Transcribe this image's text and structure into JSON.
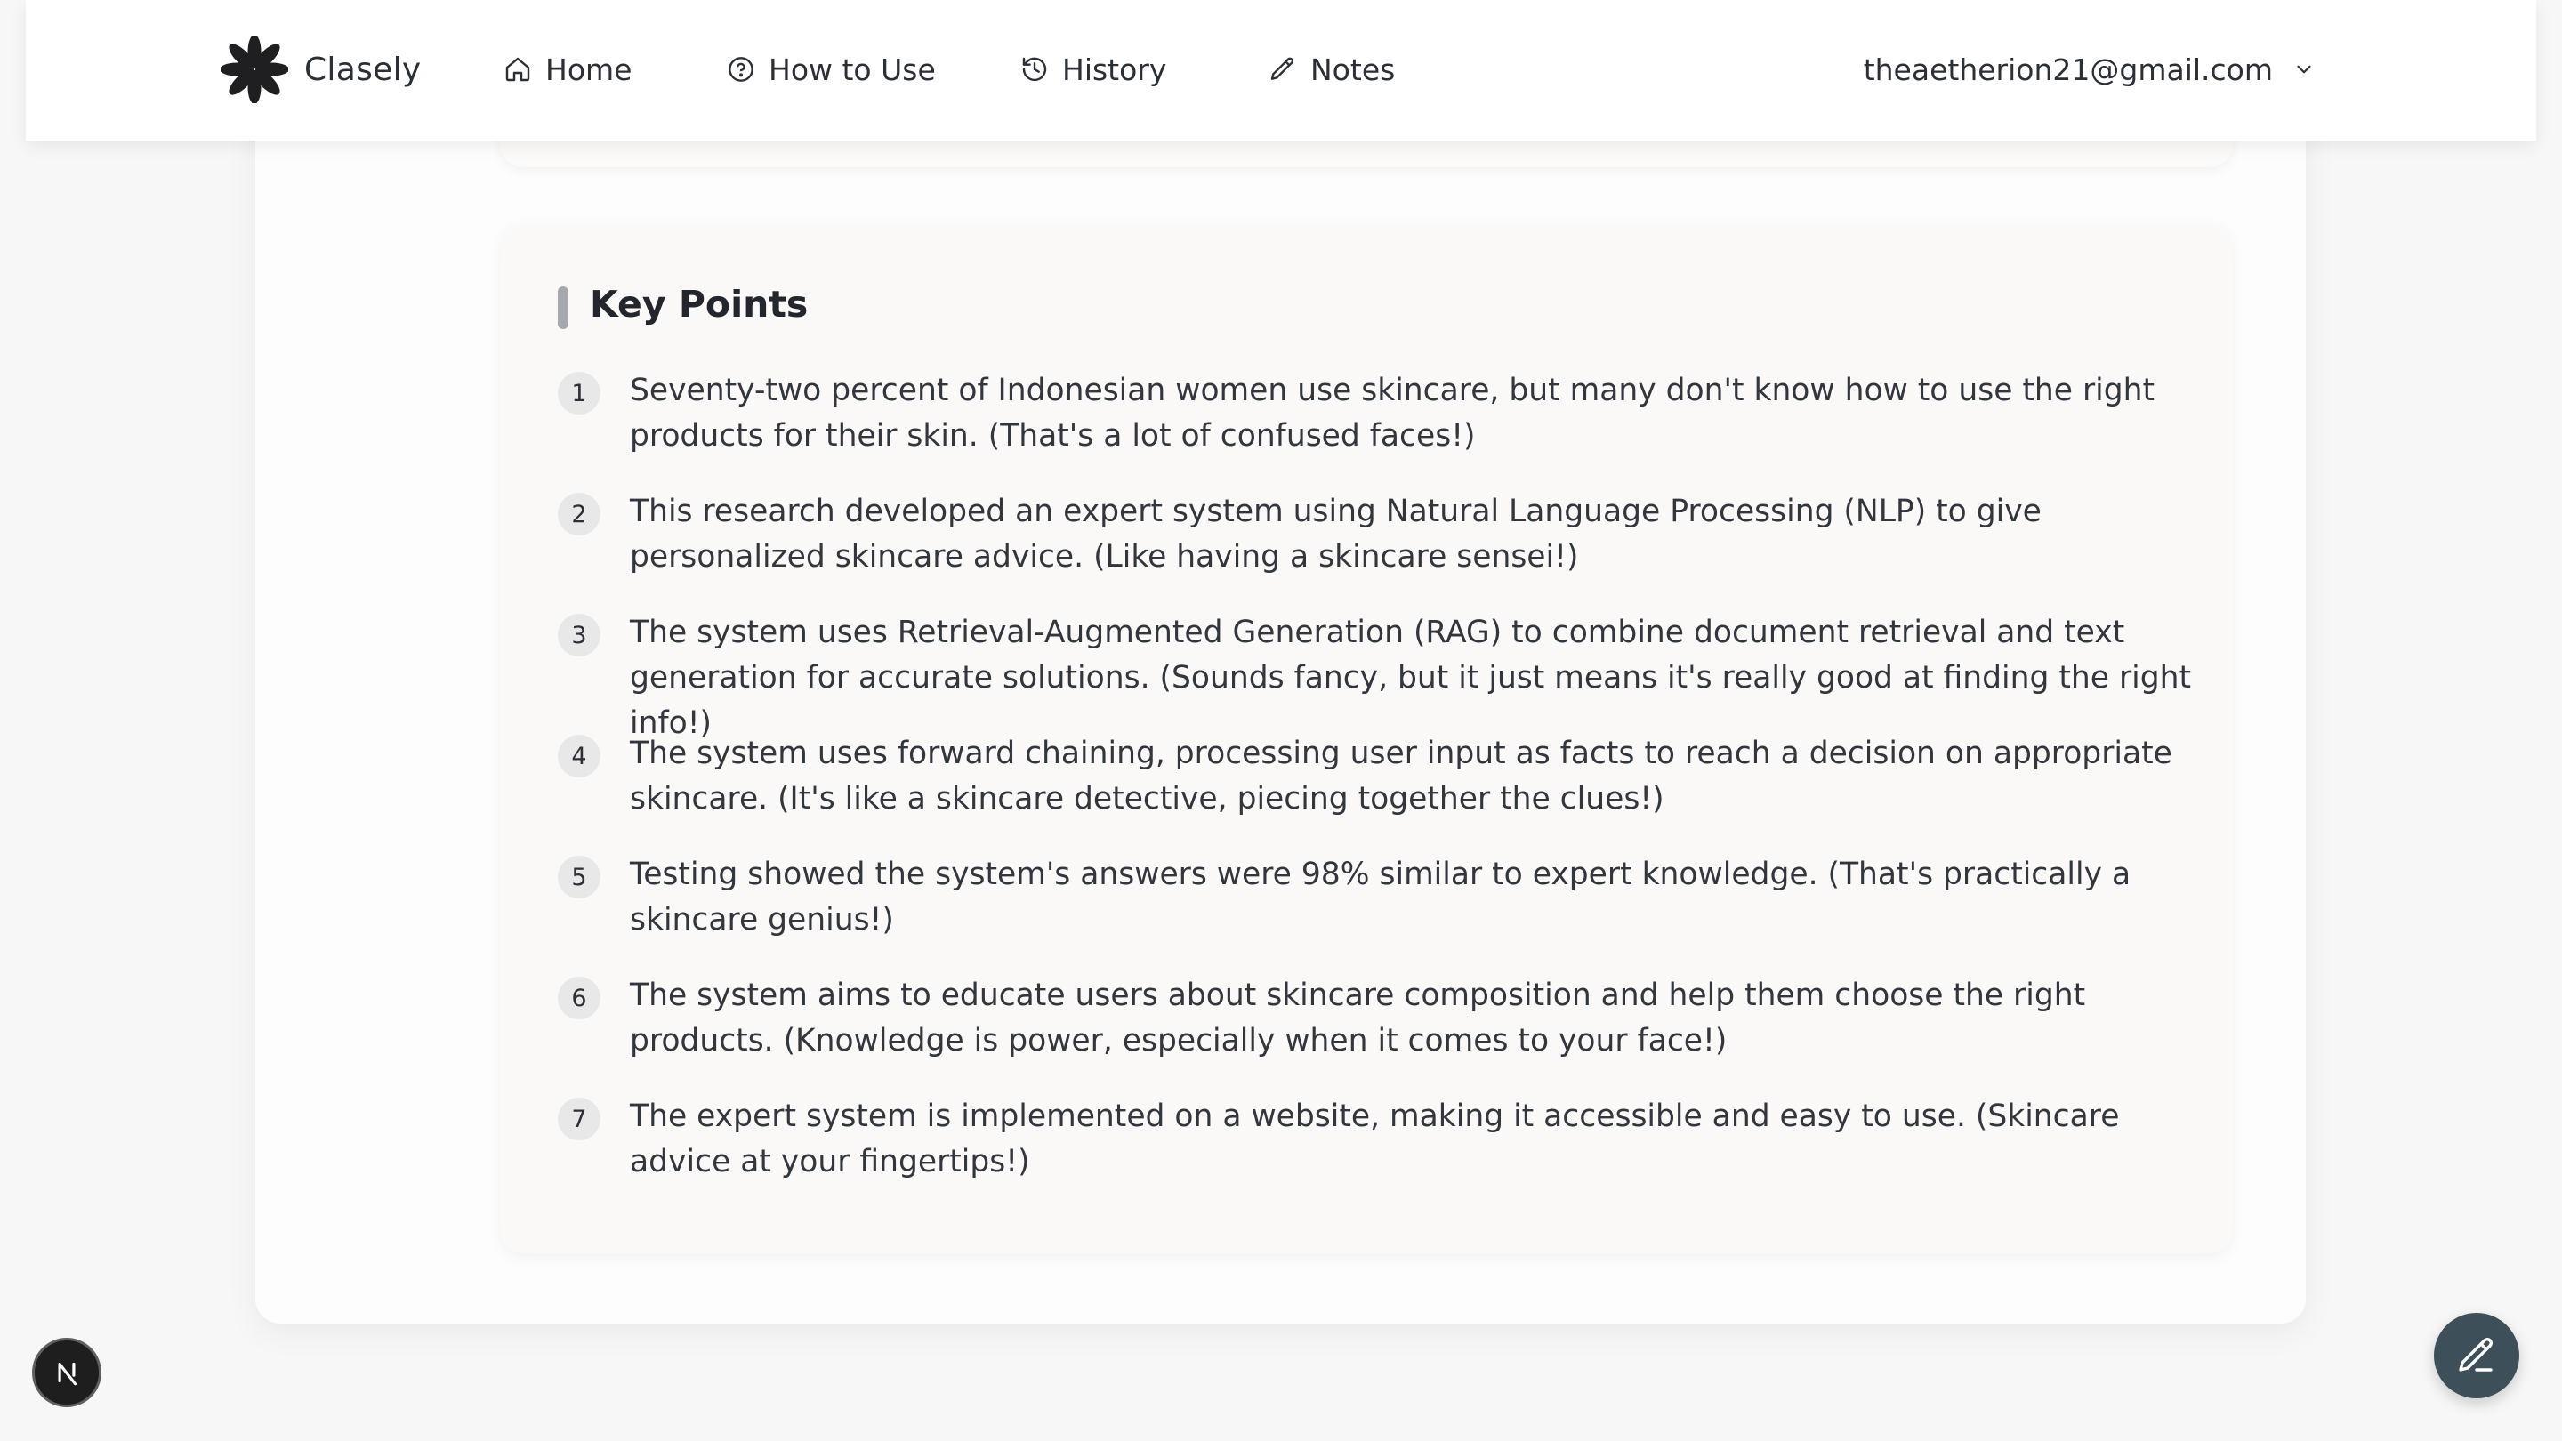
{
  "nav": {
    "brand": "Clasely",
    "items": [
      {
        "label": "Home",
        "icon": "home-icon"
      },
      {
        "label": "How to Use",
        "icon": "help-circle-icon"
      },
      {
        "label": "History",
        "icon": "history-icon"
      },
      {
        "label": "Notes",
        "icon": "pencil-icon"
      }
    ],
    "account_email": "theaetherion21@gmail.com"
  },
  "key_points": {
    "title": "Key Points",
    "items": [
      {
        "number": "1",
        "text": "Seventy-two percent of Indonesian women use skincare, but many don't know how to use the right products for their skin. (That's a lot of confused faces!)"
      },
      {
        "number": "2",
        "text": "This research developed an expert system using Natural Language Processing (NLP) to give personalized skincare advice. (Like having a skincare sensei!)"
      },
      {
        "number": "3",
        "text": "The system uses Retrieval-Augmented Generation (RAG) to combine document retrieval and text generation for accurate solutions. (Sounds fancy, but it just means it's really good at finding the right info!)"
      },
      {
        "number": "4",
        "text": "The system uses forward chaining, processing user input as facts to reach a decision on appropriate skincare. (It's like a skincare detective, piecing together the clues!)"
      },
      {
        "number": "5",
        "text": "Testing showed the system's answers were 98% similar to expert knowledge. (That's practically a skincare genius!)"
      },
      {
        "number": "6",
        "text": "The system aims to educate users about skincare composition and help them choose the right products. (Knowledge is power, especially when it comes to your face!)"
      },
      {
        "number": "7",
        "text": "The expert system is implemented on a website, making it accessible and easy to use. (Skincare advice at your fingertips!)"
      }
    ]
  },
  "colors": {
    "fab": "#3d4f58",
    "accent_bar": "#a5a8ad",
    "number_badge": "#e8e8e8"
  }
}
